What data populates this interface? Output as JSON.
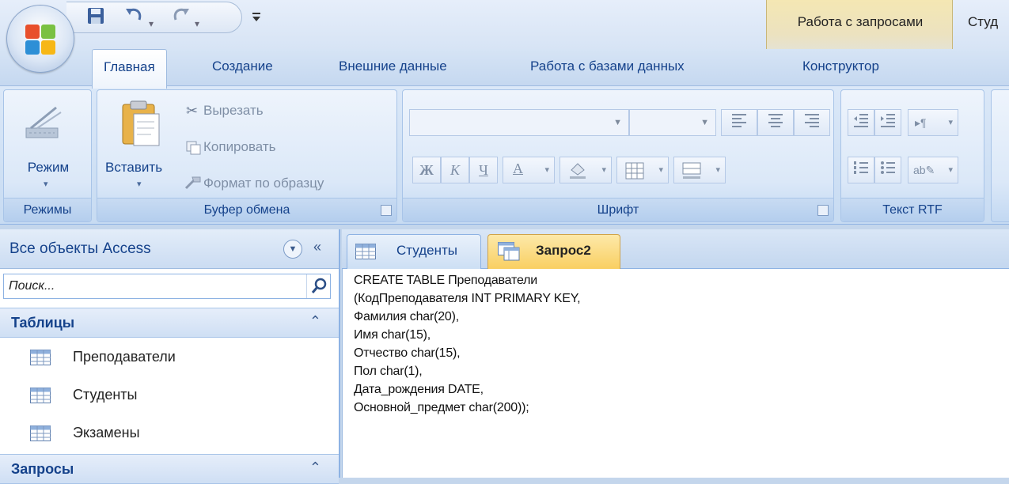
{
  "quick_access": {
    "save_icon": "save-icon",
    "undo_icon": "undo-icon",
    "redo_icon": "redo-icon",
    "customize_icon": "customize-qat-icon"
  },
  "context_group": {
    "title": "Работа с запросами"
  },
  "app_title": "Студ",
  "tabs": [
    {
      "label": "Главная",
      "active": true
    },
    {
      "label": "Создание"
    },
    {
      "label": "Внешние данные"
    },
    {
      "label": "Работа с базами данных"
    },
    {
      "label": "Конструктор"
    }
  ],
  "ribbon": {
    "views": {
      "mode_label": "Режим",
      "group_label": "Режимы"
    },
    "clipboard": {
      "paste_label": "Вставить",
      "cut_label": "Вырезать",
      "copy_label": "Копировать",
      "format_painter_label": "Формат по образцу",
      "group_label": "Буфер обмена"
    },
    "font": {
      "bold": "Ж",
      "italic": "К",
      "underline": "Ч",
      "font_color_letter": "A",
      "group_label": "Шрифт"
    },
    "rich_text": {
      "group_label": "Текст RTF"
    }
  },
  "nav": {
    "title": "Все объекты Access",
    "search_placeholder": "Поиск...",
    "categories": [
      {
        "label": "Таблицы",
        "items": [
          "Преподаватели",
          "Студенты",
          "Экзамены"
        ]
      },
      {
        "label": "Запросы",
        "items": []
      }
    ]
  },
  "document": {
    "tabs": [
      {
        "label": "Студенты",
        "icon": "table-icon",
        "active": false
      },
      {
        "label": "Запрос2",
        "icon": "query-icon",
        "active": true
      }
    ],
    "sql_lines": [
      "CREATE TABLE Преподаватели",
      "(КодПреподавателя INT PRIMARY KEY,",
      "Фамилия char(20),",
      "Имя char(15),",
      "Отчество char(15),",
      "Пол char(1),",
      "Дата_рождения DATE,",
      "Основной_предмет char(200));"
    ]
  }
}
